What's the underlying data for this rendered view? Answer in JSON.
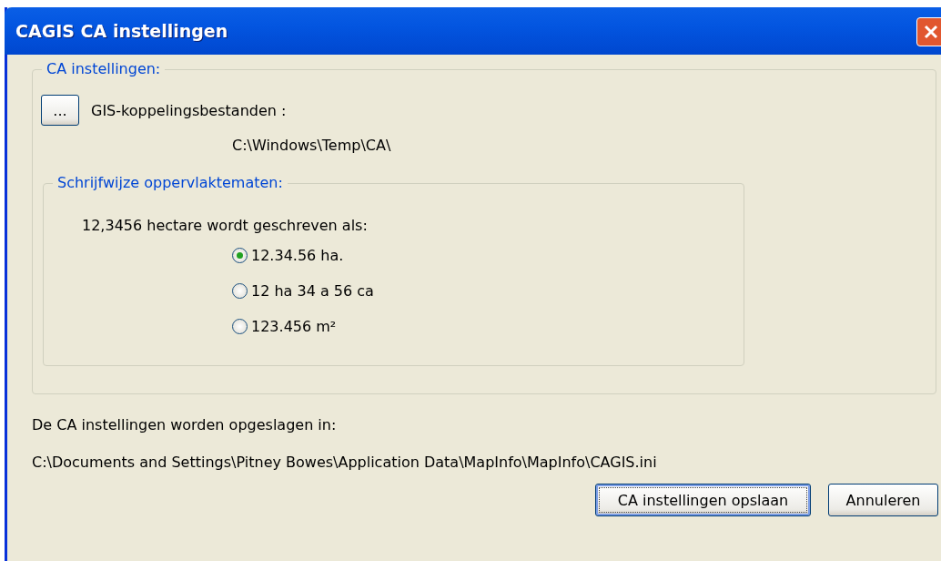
{
  "window": {
    "title": "CAGIS CA instellingen"
  },
  "ca_group": {
    "legend": "CA instellingen:",
    "browse_button": "...",
    "link_label": "GIS-koppelingsbestanden :",
    "link_path": "C:\\Windows\\Temp\\CA\\"
  },
  "area_group": {
    "legend": "Schrijfwijze oppervlaktematen:",
    "prompt": "12,3456 hectare wordt geschreven als:",
    "options": [
      {
        "label": "12.34.56 ha.",
        "selected": true
      },
      {
        "label": "12 ha 34 a 56 ca",
        "selected": false
      },
      {
        "label": "123.456 m²",
        "selected": false
      }
    ]
  },
  "storage_note": "De CA instellingen worden opgeslagen in:",
  "storage_path": "C:\\Documents and Settings\\Pitney Bowes\\Application Data\\MapInfo\\MapInfo\\CAGIS.ini",
  "buttons": [
    {
      "label": "CA instellingen opslaan",
      "default": true
    },
    {
      "label": "Annuleren",
      "default": false
    }
  ]
}
